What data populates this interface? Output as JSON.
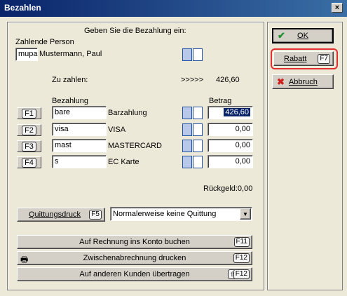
{
  "window": {
    "title": "Bezahlen",
    "close_glyph": "×"
  },
  "header": {
    "prompt": "Geben Sie die Bezahlung ein:",
    "payer_label": "Zahlende Person",
    "payer_code": "mupa",
    "payer_name": "Mustermann, Paul"
  },
  "due": {
    "label": "Zu zahlen:",
    "arrows": ">>>>>",
    "amount": "426,60"
  },
  "columns": {
    "payment": "Bezahlung",
    "amount": "Betrag"
  },
  "payments": [
    {
      "key": "F1",
      "code": "bare",
      "name": "Barzahlung",
      "amount": "426,60"
    },
    {
      "key": "F2",
      "code": "visa",
      "name": "VISA",
      "amount": "0,00"
    },
    {
      "key": "F3",
      "code": "mast",
      "name": "MASTERCARD",
      "amount": "0,00"
    },
    {
      "key": "F4",
      "code": "s",
      "name": "EC Karte",
      "amount": "0,00"
    }
  ],
  "change": {
    "label": "Rückgeld:0,00"
  },
  "receipt": {
    "button": "Quittungsdruck",
    "key": "F5",
    "option": "Normalerweise keine Quittung"
  },
  "actions": {
    "account": {
      "label": "Auf Rechnung ins Konto buchen",
      "key": "F11"
    },
    "interim": {
      "label": "Zwischenabrechnung drucken",
      "key": "F12"
    },
    "transfer": {
      "label": "Auf anderen Kunden übertragen",
      "key": "F12"
    }
  },
  "side": {
    "ok": "OK",
    "discount": "Rabatt",
    "discount_key": "F7",
    "cancel": "Abbruch"
  },
  "colors": {
    "highlight": "#e03030",
    "title_bar": "#0a246a"
  }
}
